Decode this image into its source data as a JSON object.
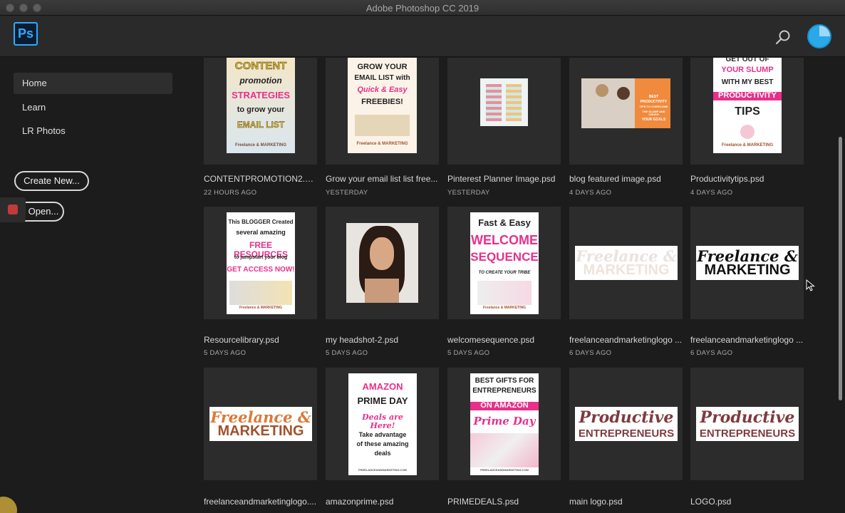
{
  "window": {
    "title": "Adobe Photoshop CC 2019",
    "controls": [
      "close",
      "minimize",
      "zoom"
    ]
  },
  "appbar": {
    "logo_text": "Ps",
    "search_icon": "search-icon",
    "avatar_icon": "user-avatar"
  },
  "sidebar": {
    "items": [
      {
        "label": "Home",
        "active": true
      },
      {
        "label": "Learn",
        "active": false
      },
      {
        "label": "LR Photos",
        "active": false
      }
    ],
    "create_new_label": "Create New...",
    "open_label": "Open..."
  },
  "files": [
    {
      "name": "CONTENTPROMOTION2.psd",
      "date": "22 HOURS AGO",
      "thumb": {
        "lines": [
          "CONTENT",
          "promotion",
          "STRATEGIES",
          "to grow your",
          "EMAIL LIST"
        ],
        "brand": "Freelance & MARKETING"
      }
    },
    {
      "name": "Grow your email list list free...",
      "date": "YESTERDAY",
      "thumb": {
        "lines": [
          "GROW YOUR",
          "EMAIL LIST with",
          "Quick & Easy",
          "FREEBIES!"
        ],
        "brand": "Freelance & MARKETING"
      }
    },
    {
      "name": "Pinterest Planner Image.psd",
      "date": "YESTERDAY",
      "thumb": {
        "lines": []
      }
    },
    {
      "name": "blog featured image.psd",
      "date": "4 DAYS AGO",
      "thumb": {
        "lines": [
          "BEST",
          "PRODUCTIVITY",
          "TIPS TO OVERCOME",
          "THE SLUMP AND CRUSH",
          "YOUR GOALS"
        ]
      }
    },
    {
      "name": "Productivitytips.psd",
      "date": "4 DAYS AGO",
      "thumb": {
        "lines": [
          "GET OUT OF",
          "YOUR SLUMP",
          "WITH MY BEST",
          "PRODUCTIVITY",
          "TIPS"
        ],
        "brand": "Freelance & MARKETING"
      }
    },
    {
      "name": "Resourcelibrary.psd",
      "date": "5 DAYS AGO",
      "thumb": {
        "lines": [
          "This BLOGGER Created",
          "several amazing",
          "FREE RESOURCES",
          "to jumpstart your blog",
          "GET ACCESS NOW!"
        ],
        "brand": "Freelance & MARKETING"
      }
    },
    {
      "name": "my headshot-2.psd",
      "date": "5 DAYS AGO",
      "thumb": {
        "lines": []
      }
    },
    {
      "name": "welcomesequence.psd",
      "date": "5 DAYS AGO",
      "thumb": {
        "lines": [
          "Fast & Easy",
          "WELCOME",
          "SEQUENCE",
          "TO CREATE YOUR TRIBE"
        ],
        "brand": "Freelance & MARKETING"
      }
    },
    {
      "name": "freelanceandmarketinglogo ...",
      "date": "6 DAYS AGO",
      "thumb": {
        "lines": [
          "Freelance &",
          "MARKETING"
        ]
      }
    },
    {
      "name": "freelanceandmarketinglogo ...",
      "date": "6 DAYS AGO",
      "thumb": {
        "lines": [
          "Freelance &",
          "MARKETING"
        ]
      }
    },
    {
      "name": "freelanceandmarketinglogo....",
      "date": "",
      "thumb": {
        "lines": [
          "Freelance &",
          "MARKETING"
        ]
      }
    },
    {
      "name": "amazonprime.psd",
      "date": "",
      "thumb": {
        "lines": [
          "AMAZON",
          "PRIME DAY",
          "Deals are Here!",
          "Take advantage",
          "of these amazing",
          "deals",
          "FREELANCEANDMARKETING.COM"
        ]
      }
    },
    {
      "name": "PRIMEDEALS.psd",
      "date": "",
      "thumb": {
        "lines": [
          "BEST GIFTS FOR",
          "ENTREPRENEURS",
          "ON AMAZON",
          "Prime Day",
          "FREELANCEANDMARKETING.COM"
        ]
      }
    },
    {
      "name": "main logo.psd",
      "date": "",
      "thumb": {
        "lines": [
          "Productive",
          "ENTREPRENEURS"
        ]
      }
    },
    {
      "name": "LOGO.psd",
      "date": "",
      "thumb": {
        "lines": [
          "Productive",
          "ENTREPRENEURS"
        ]
      }
    }
  ],
  "colors": {
    "accent": "#31a8ff",
    "pink": "#e8308a",
    "brown": "#a0522d"
  }
}
